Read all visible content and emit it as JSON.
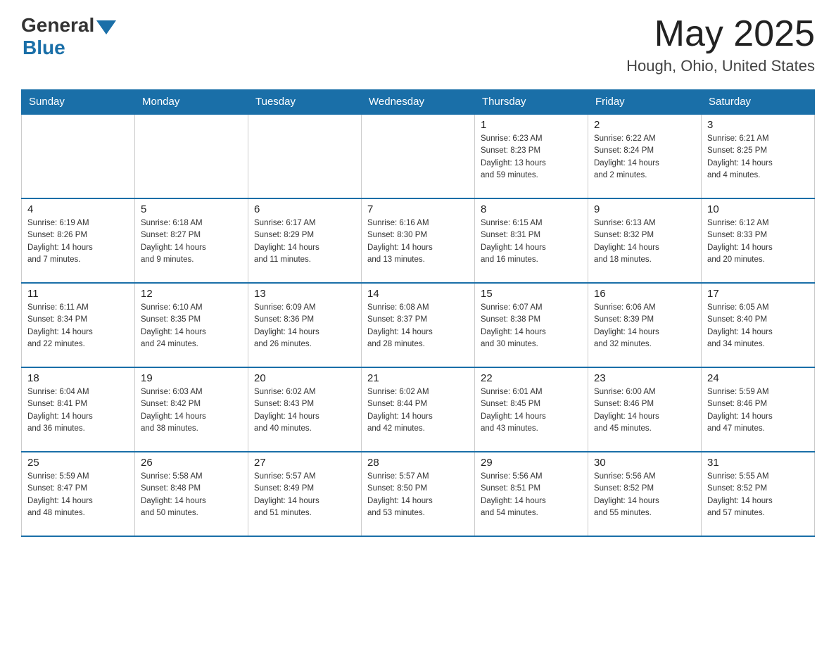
{
  "header": {
    "logo_general": "General",
    "logo_blue": "Blue",
    "month_year": "May 2025",
    "location": "Hough, Ohio, United States"
  },
  "days_of_week": [
    "Sunday",
    "Monday",
    "Tuesday",
    "Wednesday",
    "Thursday",
    "Friday",
    "Saturday"
  ],
  "weeks": [
    [
      {
        "day": "",
        "info": ""
      },
      {
        "day": "",
        "info": ""
      },
      {
        "day": "",
        "info": ""
      },
      {
        "day": "",
        "info": ""
      },
      {
        "day": "1",
        "info": "Sunrise: 6:23 AM\nSunset: 8:23 PM\nDaylight: 13 hours\nand 59 minutes."
      },
      {
        "day": "2",
        "info": "Sunrise: 6:22 AM\nSunset: 8:24 PM\nDaylight: 14 hours\nand 2 minutes."
      },
      {
        "day": "3",
        "info": "Sunrise: 6:21 AM\nSunset: 8:25 PM\nDaylight: 14 hours\nand 4 minutes."
      }
    ],
    [
      {
        "day": "4",
        "info": "Sunrise: 6:19 AM\nSunset: 8:26 PM\nDaylight: 14 hours\nand 7 minutes."
      },
      {
        "day": "5",
        "info": "Sunrise: 6:18 AM\nSunset: 8:27 PM\nDaylight: 14 hours\nand 9 minutes."
      },
      {
        "day": "6",
        "info": "Sunrise: 6:17 AM\nSunset: 8:29 PM\nDaylight: 14 hours\nand 11 minutes."
      },
      {
        "day": "7",
        "info": "Sunrise: 6:16 AM\nSunset: 8:30 PM\nDaylight: 14 hours\nand 13 minutes."
      },
      {
        "day": "8",
        "info": "Sunrise: 6:15 AM\nSunset: 8:31 PM\nDaylight: 14 hours\nand 16 minutes."
      },
      {
        "day": "9",
        "info": "Sunrise: 6:13 AM\nSunset: 8:32 PM\nDaylight: 14 hours\nand 18 minutes."
      },
      {
        "day": "10",
        "info": "Sunrise: 6:12 AM\nSunset: 8:33 PM\nDaylight: 14 hours\nand 20 minutes."
      }
    ],
    [
      {
        "day": "11",
        "info": "Sunrise: 6:11 AM\nSunset: 8:34 PM\nDaylight: 14 hours\nand 22 minutes."
      },
      {
        "day": "12",
        "info": "Sunrise: 6:10 AM\nSunset: 8:35 PM\nDaylight: 14 hours\nand 24 minutes."
      },
      {
        "day": "13",
        "info": "Sunrise: 6:09 AM\nSunset: 8:36 PM\nDaylight: 14 hours\nand 26 minutes."
      },
      {
        "day": "14",
        "info": "Sunrise: 6:08 AM\nSunset: 8:37 PM\nDaylight: 14 hours\nand 28 minutes."
      },
      {
        "day": "15",
        "info": "Sunrise: 6:07 AM\nSunset: 8:38 PM\nDaylight: 14 hours\nand 30 minutes."
      },
      {
        "day": "16",
        "info": "Sunrise: 6:06 AM\nSunset: 8:39 PM\nDaylight: 14 hours\nand 32 minutes."
      },
      {
        "day": "17",
        "info": "Sunrise: 6:05 AM\nSunset: 8:40 PM\nDaylight: 14 hours\nand 34 minutes."
      }
    ],
    [
      {
        "day": "18",
        "info": "Sunrise: 6:04 AM\nSunset: 8:41 PM\nDaylight: 14 hours\nand 36 minutes."
      },
      {
        "day": "19",
        "info": "Sunrise: 6:03 AM\nSunset: 8:42 PM\nDaylight: 14 hours\nand 38 minutes."
      },
      {
        "day": "20",
        "info": "Sunrise: 6:02 AM\nSunset: 8:43 PM\nDaylight: 14 hours\nand 40 minutes."
      },
      {
        "day": "21",
        "info": "Sunrise: 6:02 AM\nSunset: 8:44 PM\nDaylight: 14 hours\nand 42 minutes."
      },
      {
        "day": "22",
        "info": "Sunrise: 6:01 AM\nSunset: 8:45 PM\nDaylight: 14 hours\nand 43 minutes."
      },
      {
        "day": "23",
        "info": "Sunrise: 6:00 AM\nSunset: 8:46 PM\nDaylight: 14 hours\nand 45 minutes."
      },
      {
        "day": "24",
        "info": "Sunrise: 5:59 AM\nSunset: 8:46 PM\nDaylight: 14 hours\nand 47 minutes."
      }
    ],
    [
      {
        "day": "25",
        "info": "Sunrise: 5:59 AM\nSunset: 8:47 PM\nDaylight: 14 hours\nand 48 minutes."
      },
      {
        "day": "26",
        "info": "Sunrise: 5:58 AM\nSunset: 8:48 PM\nDaylight: 14 hours\nand 50 minutes."
      },
      {
        "day": "27",
        "info": "Sunrise: 5:57 AM\nSunset: 8:49 PM\nDaylight: 14 hours\nand 51 minutes."
      },
      {
        "day": "28",
        "info": "Sunrise: 5:57 AM\nSunset: 8:50 PM\nDaylight: 14 hours\nand 53 minutes."
      },
      {
        "day": "29",
        "info": "Sunrise: 5:56 AM\nSunset: 8:51 PM\nDaylight: 14 hours\nand 54 minutes."
      },
      {
        "day": "30",
        "info": "Sunrise: 5:56 AM\nSunset: 8:52 PM\nDaylight: 14 hours\nand 55 minutes."
      },
      {
        "day": "31",
        "info": "Sunrise: 5:55 AM\nSunset: 8:52 PM\nDaylight: 14 hours\nand 57 minutes."
      }
    ]
  ]
}
